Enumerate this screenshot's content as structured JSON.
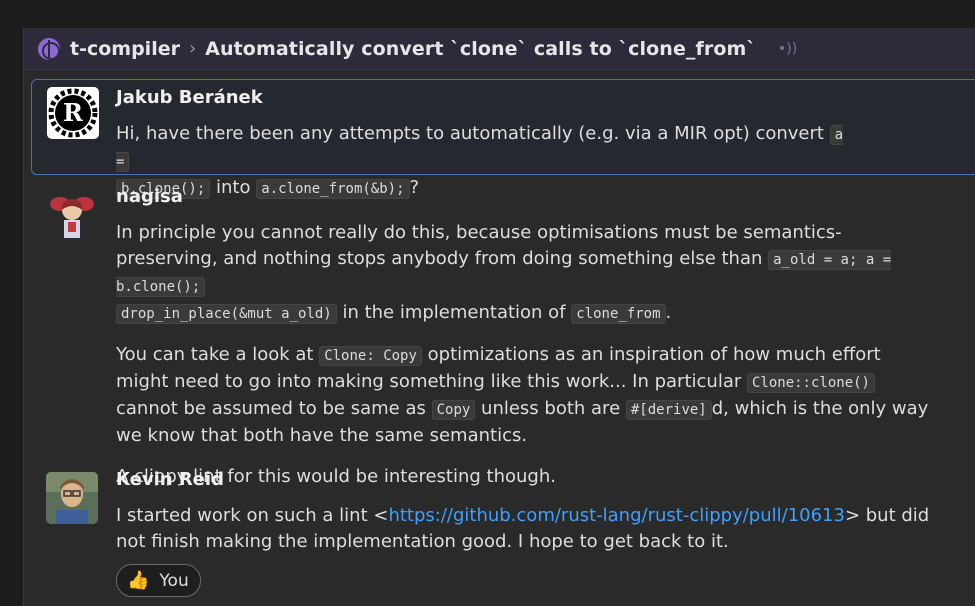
{
  "header": {
    "stream": "t-compiler",
    "chevron": "›",
    "topic": "Automatically convert `clone` calls to `clone_from`"
  },
  "messages": [
    {
      "sender": "Jakub Beránek",
      "avatar": "rust-logo",
      "text_a": "Hi, have there been any attempts to automatically (e.g. via a MIR opt) convert ",
      "code_a": "a =",
      "code_b": "b.clone();",
      "text_b": " into ",
      "code_c": "a.clone_from(&b);",
      "text_c": "?"
    },
    {
      "sender": "nagisa",
      "avatar": "nagisa-avatar",
      "p1_text_a": "In principle you cannot really do this, because optimisations must be semantics-preserving, and nothing stops anybody from doing something else than ",
      "p1_code_a": "a_old = a; a = b.clone();",
      "p1_code_b": "drop_in_place(&mut a_old)",
      "p1_text_b": " in the implementation of ",
      "p1_code_c": "clone_from",
      "p1_text_c": ".",
      "p2_text_a": "You can take a look at ",
      "p2_code_a": "Clone: Copy",
      "p2_text_b": " optimizations as an inspiration of how much effort might need to go into making something like this work... In particular ",
      "p2_code_b": "Clone::clone()",
      "p2_text_c": " cannot be assumed to be same as ",
      "p2_code_c": "Copy",
      "p2_text_d": " unless both are ",
      "p2_code_d": "#[derive]",
      "p2_text_e": "d, which is the only way we know that both have the same semantics.",
      "p3": "A clippy lint for this would be interesting though."
    },
    {
      "sender": "Kevin Reid",
      "avatar": "kevin-avatar",
      "text_a": "I started work on such a lint <",
      "link": "https://github.com/rust-lang/rust-clippy/pull/10613",
      "text_b": "> but did not finish making the implementation good. I hope to get back to it."
    }
  ],
  "reaction": {
    "emoji": "👍",
    "label": "You"
  }
}
